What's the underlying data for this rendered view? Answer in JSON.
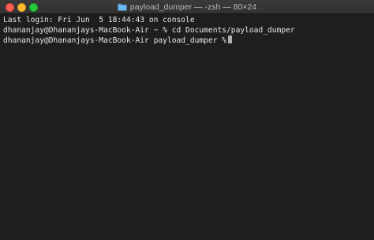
{
  "window": {
    "title": "payload_dumper — -zsh — 80×24",
    "title_icon": "folder-icon",
    "traffic_lights": {
      "close_color": "#ff5f57",
      "minimize_color": "#febc2e",
      "zoom_color": "#28c840"
    }
  },
  "terminal": {
    "background": "#1e1e1e",
    "text_color": "#e8e8e8",
    "lines": [
      "Last login: Fri Jun  5 18:44:43 on console",
      "dhananjay@Dhananjays-MacBook-Air ~ % cd Documents/payload_dumper",
      "dhananjay@Dhananjays-MacBook-Air payload_dumper %"
    ]
  }
}
